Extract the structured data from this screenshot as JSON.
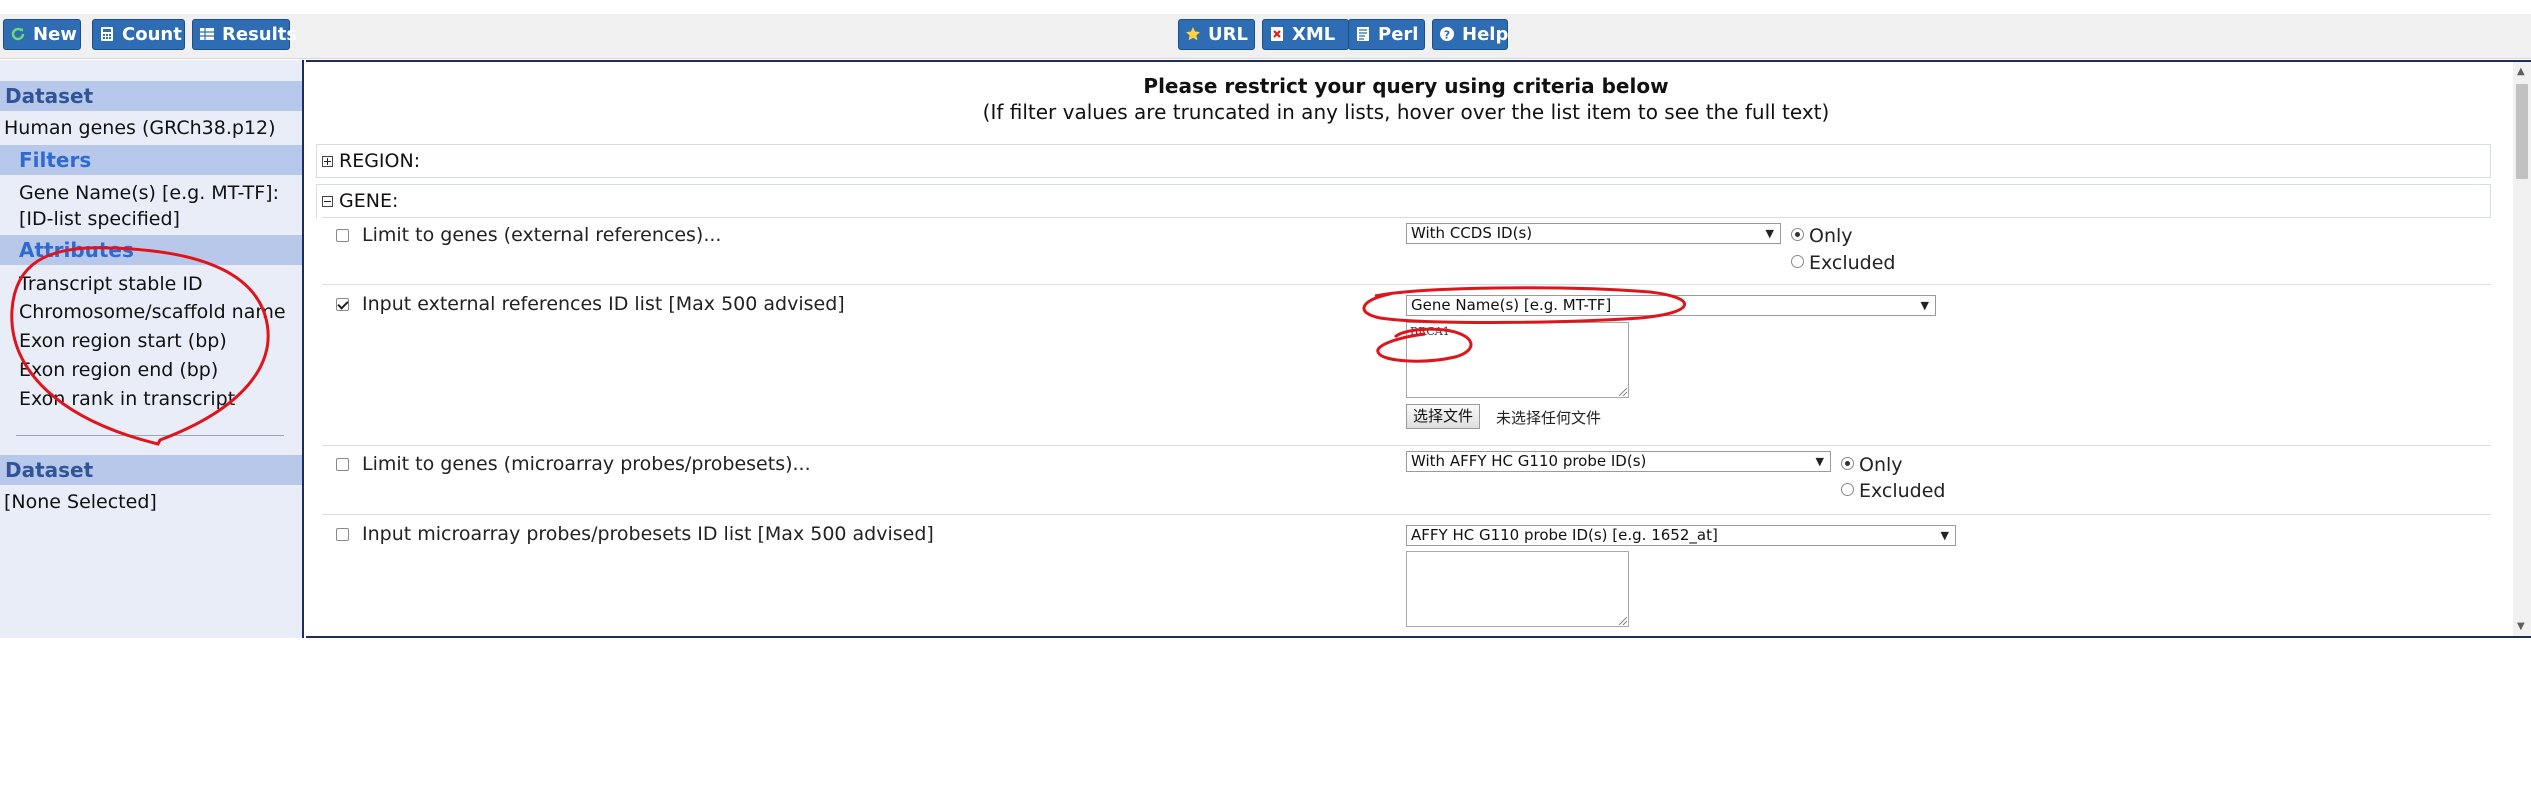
{
  "toolbar": {
    "new_label": "New",
    "count_label": "Count",
    "results_label": "Results",
    "url_label": "URL",
    "xml_label": "XML",
    "perl_label": "Perl",
    "help_label": "Help"
  },
  "sidebar": {
    "dataset_header": "Dataset",
    "dataset_name": "Human genes (GRCh38.p12)",
    "filters_header": "Filters",
    "filter_line1": "Gene Name(s) [e.g. MT-TF]:",
    "filter_line2": "[ID-list specified]",
    "attributes_header": "Attributes",
    "attributes": [
      "Transcript stable ID",
      "Chromosome/scaffold name",
      "Exon region start (bp)",
      "Exon region end (bp)",
      "Exon rank in transcript"
    ],
    "dataset2_header": "Dataset",
    "dataset2_value": "[None Selected]"
  },
  "main": {
    "title": "Please restrict your query using criteria below",
    "subtitle": "(If filter values are truncated in any lists, hover over the list item to see the full text)",
    "region_label": "REGION:",
    "gene_label": "GENE:",
    "filters": {
      "limit_ext": {
        "label": "Limit to genes (external references)...",
        "select": "With CCDS ID(s)",
        "only": "Only",
        "excluded": "Excluded"
      },
      "input_ext": {
        "label": "Input external references ID list [Max 500 advised]",
        "select": "Gene Name(s) [e.g. MT-TF]",
        "textarea": "BRCA1",
        "file_button": "选择文件",
        "file_status": "未选择任何文件"
      },
      "limit_probe": {
        "label": "Limit to genes (microarray probes/probesets)...",
        "select": "With AFFY HC G110 probe ID(s)",
        "only": "Only",
        "excluded": "Excluded"
      },
      "input_probe": {
        "label": "Input microarray probes/probesets ID list [Max 500 advised]",
        "select": "AFFY HC G110 probe ID(s) [e.g. 1652_at]",
        "textarea": ""
      }
    }
  },
  "colors": {
    "toolbar_button": "#2e6db4",
    "sidebar_bg": "#e8edf8",
    "section_header": "#b8c8eb",
    "annotation": "#e0141b"
  }
}
